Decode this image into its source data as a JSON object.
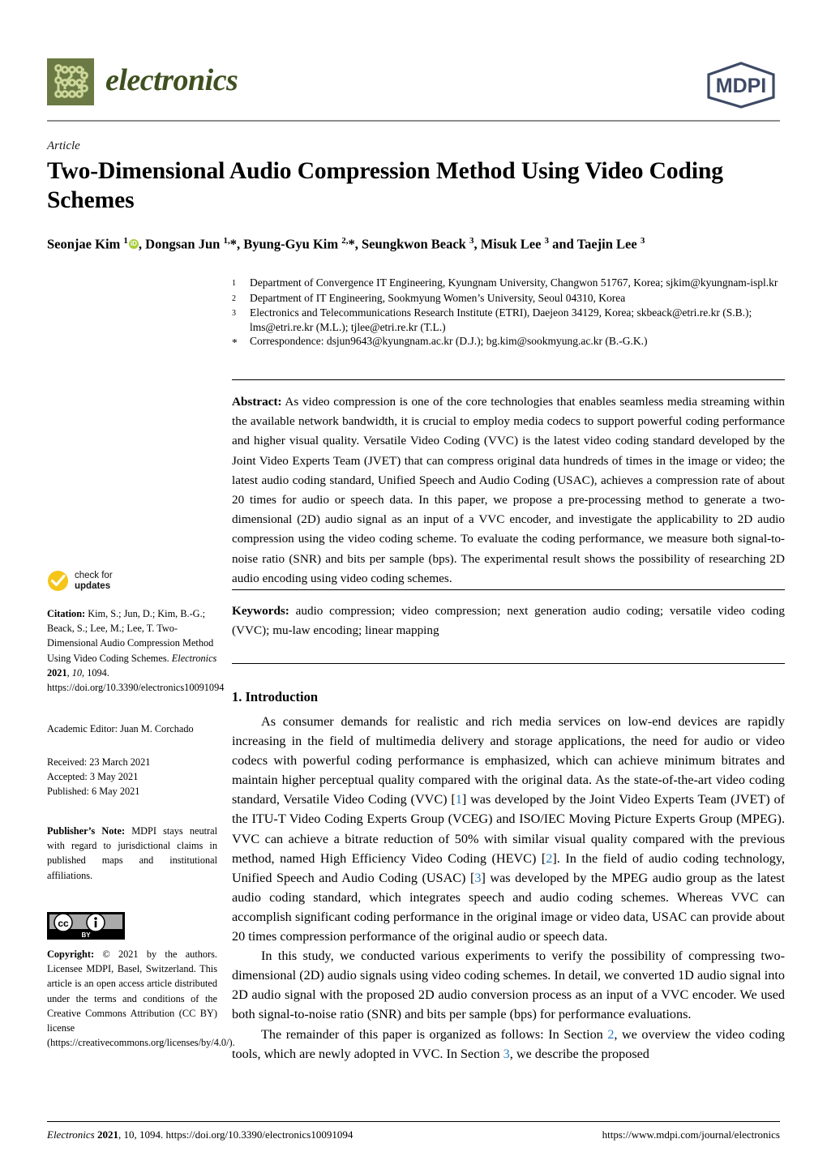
{
  "journal": {
    "name": "electronics",
    "publisher": "MDPI",
    "logo_bg_color": "#6b7a44",
    "wordmark_color": "#3f5020"
  },
  "article": {
    "type": "Article",
    "title": "Two-Dimensional Audio Compression Method Using Video Coding Schemes",
    "authors_html": "Seonjae Kim <sup>1</sup><span class=\"orcid\" data-name=\"orcid-icon\" data-interactable=\"true\">iD</span>, Dongsan Jun <sup>1,</sup>*, Byung-Gyu Kim <sup>2,</sup>*, Seungkwon Beack <sup>3</sup>, Misuk Lee <sup>3</sup> and Taejin Lee <sup>3</sup>"
  },
  "affiliations": [
    {
      "marker": "1",
      "text": "Department of Convergence IT Engineering, Kyungnam University, Changwon 51767, Korea; sjkim@kyungnam-ispl.kr"
    },
    {
      "marker": "2",
      "text": "Department of IT Engineering, Sookmyung Women’s University, Seoul 04310, Korea"
    },
    {
      "marker": "3",
      "text": "Electronics and Telecommunications Research Institute (ETRI), Daejeon 34129, Korea; skbeack@etri.re.kr (S.B.); lms@etri.re.kr (M.L.); tjlee@etri.re.kr (T.L.)"
    },
    {
      "marker": "*",
      "text": "Correspondence: dsjun9643@kyungnam.ac.kr (D.J.); bg.kim@sookmyung.ac.kr (B.-G.K.)"
    }
  ],
  "abstract": {
    "label": "Abstract:",
    "text": "As video compression is one of the core technologies that enables seamless media streaming within the available network bandwidth, it is crucial to employ media codecs to support powerful coding performance and higher visual quality. Versatile Video Coding (VVC) is the latest video coding standard developed by the Joint Video Experts Team (JVET) that can compress original data hundreds of times in the image or video; the latest audio coding standard, Unified Speech and Audio Coding (USAC), achieves a compression rate of about 20 times for audio or speech data. In this paper, we propose a pre-processing method to generate a two-dimensional (2D) audio signal as an input of a VVC encoder, and investigate the applicability to 2D audio compression using the video coding scheme. To evaluate the coding performance, we measure both signal-to-noise ratio (SNR) and bits per sample (bps). The experimental result shows the possibility of researching 2D audio encoding using video coding schemes."
  },
  "keywords": {
    "label": "Keywords:",
    "text": "audio compression; video compression; next generation audio coding; versatile video coding (VVC); mu-law encoding; linear mapping"
  },
  "body": {
    "section_heading": "1. Introduction",
    "paragraph_1_part_1": "As consumer demands for realistic and rich media services on low-end devices are rapidly increasing in the field of multimedia delivery and storage applications, the need for audio or video codecs with powerful coding performance is emphasized, which can achieve minimum bitrates and maintain higher perceptual quality compared with the original data. As the state-of-the-art video coding standard, Versatile Video Coding (VVC) [",
    "ref_1": "1",
    "paragraph_1_part_2": "] was developed by the Joint Video Experts Team (JVET) of the ITU-T Video Coding Experts Group (VCEG) and ISO/IEC Moving Picture Experts Group (MPEG). VVC can achieve a bitrate reduction of 50% with similar visual quality compared with the previous method, named High Efficiency Video Coding (HEVC) [",
    "ref_2": "2",
    "paragraph_1_part_3": "]. In the field of audio coding technology, Unified Speech and Audio Coding (USAC) [",
    "ref_3": "3",
    "paragraph_1_part_4": "] was developed by the MPEG audio group as the latest audio coding standard, which integrates speech and audio coding schemes. Whereas VVC can accomplish significant coding performance in the original image or video data, USAC can provide about 20 times compression performance of the original audio or speech data.",
    "paragraph_2": "In this study, we conducted various experiments to verify the possibility of compressing two-dimensional (2D) audio signals using video coding schemes. In detail, we converted 1D audio signal into 2D audio signal with the proposed 2D audio conversion process as an input of a VVC encoder. We used both signal-to-noise ratio (SNR) and bits per sample (bps) for performance evaluations.",
    "paragraph_3_part_1": "The remainder of this paper is organized as follows: In Section ",
    "ref_sec_2": "2",
    "paragraph_3_part_2": ", we overview the video coding tools, which are newly adopted in VVC. In Section ",
    "ref_sec_3": "3",
    "paragraph_3_part_3": ", we describe the proposed",
    "ref_color": "#2b7dc1"
  },
  "sidebar": {
    "check_for_updates": {
      "line1": "check for",
      "line2": "updates",
      "badge_color": "#f5c518"
    },
    "citation_label": "Citation:",
    "citation_text": " Kim, S.; Jun, D.; Kim, B.-G.; Beack, S.; Lee, M.; Lee, T. Two-Dimensional Audio Compression Method Using Video Coding Schemes. ",
    "citation_journal": "Electronics",
    "citation_year": "2021",
    "citation_volume": "10",
    "citation_pages": ", 1094.  https://doi.org/10.3390/electronics10091094",
    "academic_editor": "Academic Editor: Juan M. Corchado",
    "received": "Received: 23 March 2021",
    "accepted": "Accepted: 3 May 2021",
    "published": "Published: 6 May 2021",
    "publisher_note_label": "Publisher’s Note:",
    "publisher_note_text": " MDPI stays neutral with regard to jurisdictional claims in published maps and institutional affiliations.",
    "copyright_label": "Copyright:",
    "copyright_text": " © 2021 by the authors. Licensee MDPI, Basel, Switzerland. This article is an open access article distributed under the terms and conditions of the Creative Commons Attribution (CC BY) license (https://creativecommons.org/licenses/by/4.0/).",
    "cc_badge_text": "BY"
  },
  "footer": {
    "left_journal": "Electronics",
    "left_year": "2021",
    "left_rest": ", 10, 1094. https://doi.org/10.3390/electronics10091094",
    "right": "https://www.mdpi.com/journal/electronics"
  }
}
